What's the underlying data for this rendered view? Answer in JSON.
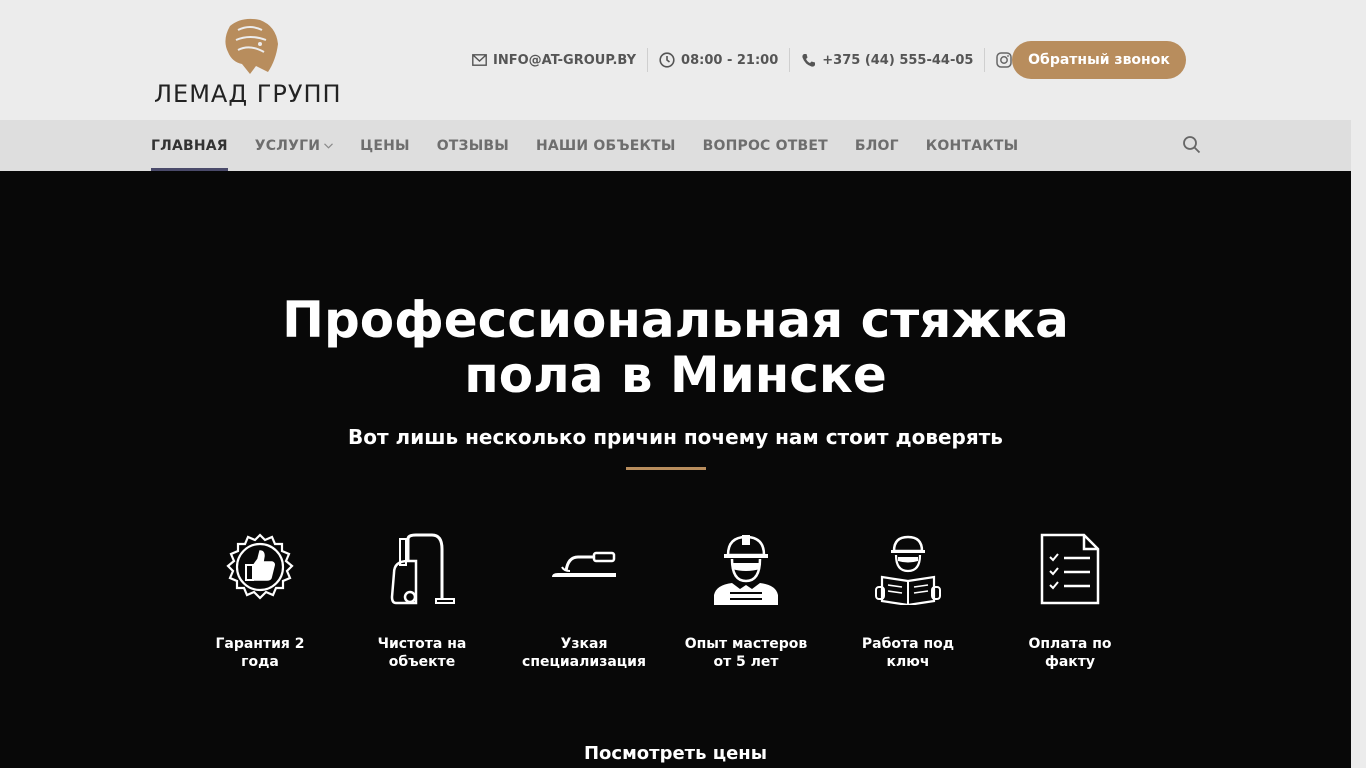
{
  "header": {
    "logo_text": "ЛЕМАД ГРУПП",
    "email": "INFO@AT-GROUP.BY",
    "hours": "08:00 - 21:00",
    "phone": "+375 (44) 555-44-05",
    "callback_label": "Обратный звонок"
  },
  "nav": {
    "items": [
      {
        "label": "ГЛАВНАЯ"
      },
      {
        "label": "УСЛУГИ"
      },
      {
        "label": "ЦЕНЫ"
      },
      {
        "label": "ОТЗЫВЫ"
      },
      {
        "label": "НАШИ ОБЪЕКТЫ"
      },
      {
        "label": "ВОПРОС ОТВЕТ"
      },
      {
        "label": "БЛОГ"
      },
      {
        "label": "КОНТАКТЫ"
      }
    ]
  },
  "hero": {
    "title_line1": "Профессиональная стяжка",
    "title_line2": "пола в Минске",
    "subtitle": "Вот лишь несколько причин почему нам стоит доверять",
    "features": [
      {
        "line1": "Гарантия 2",
        "line2": "года",
        "icon": "thumbs-up-badge-icon"
      },
      {
        "line1": "Чистота на",
        "line2": "объекте",
        "icon": "vacuum-cleaner-icon"
      },
      {
        "line1": "Узкая",
        "line2": "специализация",
        "icon": "trowel-icon"
      },
      {
        "line1": "Опыт мастеров",
        "line2": "от 5 лет",
        "icon": "worker-icon"
      },
      {
        "line1": "Работа под",
        "line2": "ключ",
        "icon": "engineer-blueprint-icon"
      },
      {
        "line1": "Оплата по",
        "line2": "факту",
        "icon": "checklist-document-icon"
      }
    ],
    "prices_link": "Посмотреть цены"
  },
  "colors": {
    "accent": "#b88d5d",
    "hero_bg": "#080808",
    "header_bg": "#ececec",
    "nav_bg": "#dedede"
  }
}
